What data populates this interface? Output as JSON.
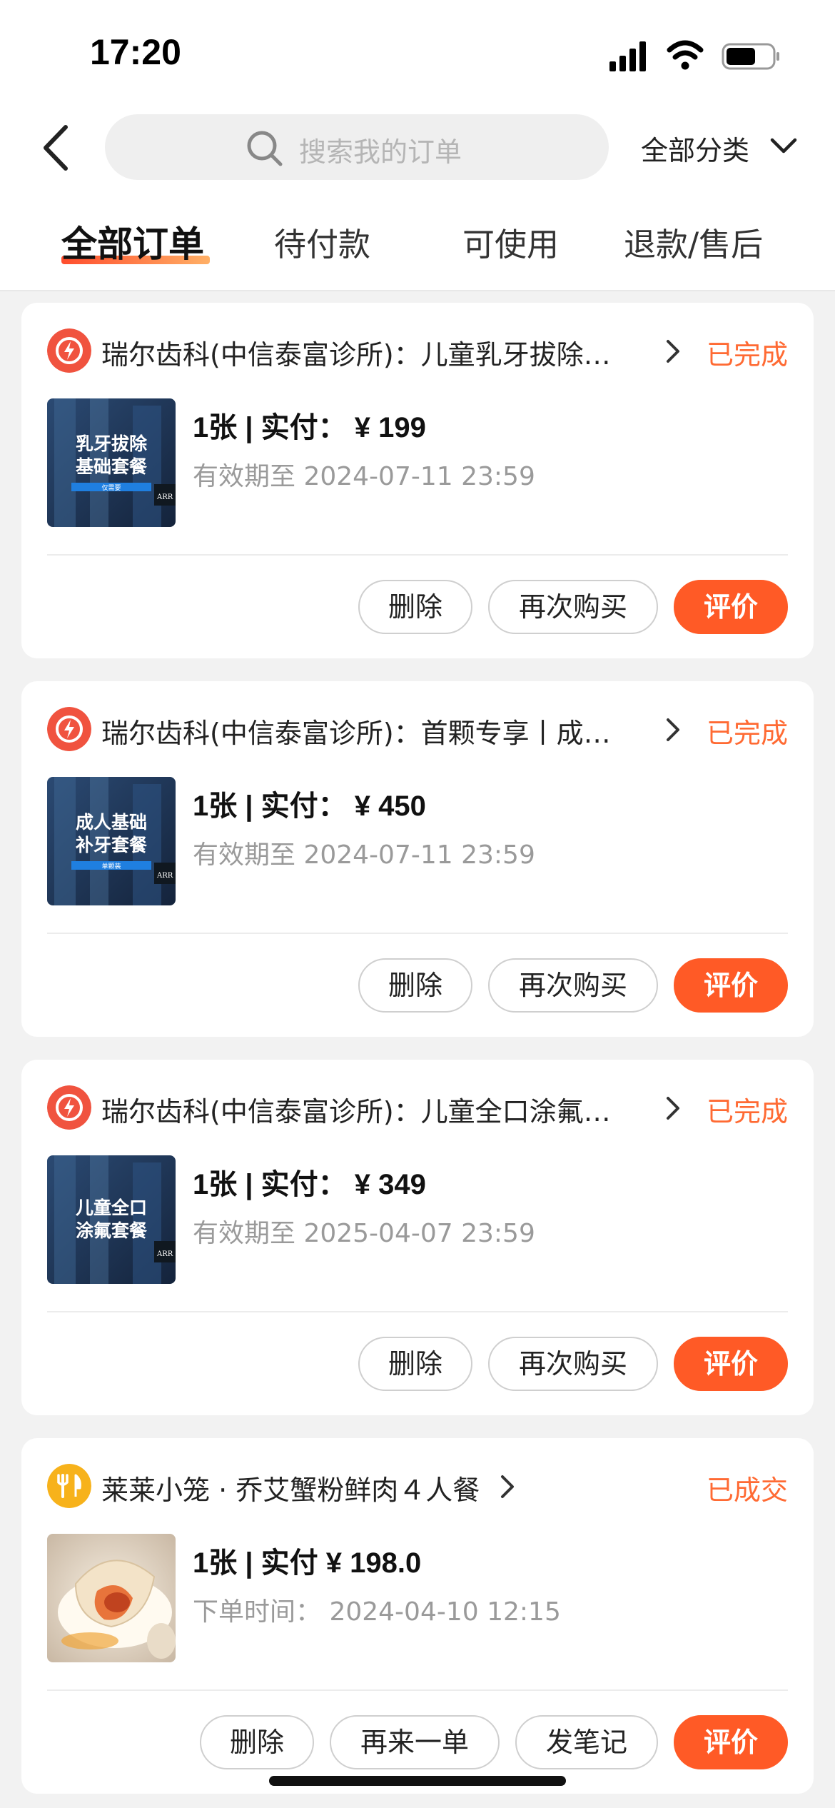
{
  "status_bar": {
    "time": "17:20"
  },
  "header": {
    "search_placeholder": "搜索我的订单",
    "category_label": "全部分类"
  },
  "tabs": [
    {
      "label": "全部订单",
      "active": true
    },
    {
      "label": "待付款",
      "active": false
    },
    {
      "label": "可使用",
      "active": false
    },
    {
      "label": "退款/售后",
      "active": false
    }
  ],
  "orders": [
    {
      "shop_icon": "lightning-icon",
      "title": "瑞尔齿科(中信泰富诊所)：儿童乳牙拔除…",
      "status": "已完成",
      "thumb_text": [
        "乳牙拔除",
        "基础套餐"
      ],
      "thumb_tag": "仅需要",
      "price_line": "1张 | 实付： ¥ 199",
      "detail": "有效期至 2024-07-11 23:59",
      "buttons": [
        "删除",
        "再次购买",
        "评价"
      ]
    },
    {
      "shop_icon": "lightning-icon",
      "title": "瑞尔齿科(中信泰富诊所)：首颗专享丨成…",
      "status": "已完成",
      "thumb_text": [
        "成人基础",
        "补牙套餐"
      ],
      "thumb_tag": "单颗装",
      "price_line": "1张 | 实付： ¥ 450",
      "detail": "有效期至 2024-07-11 23:59",
      "buttons": [
        "删除",
        "再次购买",
        "评价"
      ]
    },
    {
      "shop_icon": "lightning-icon",
      "title": "瑞尔齿科(中信泰富诊所)：儿童全口涂氟…",
      "status": "已完成",
      "thumb_text": [
        "儿童全口",
        "涂氟套餐"
      ],
      "thumb_tag": "",
      "price_line": "1张 | 实付： ¥ 349",
      "detail": "有效期至 2025-04-07 23:59",
      "buttons": [
        "删除",
        "再次购买",
        "评价"
      ]
    },
    {
      "shop_icon": "fork-knife-icon",
      "title": "莱莱小笼 · 乔艾蟹粉鲜肉４人餐",
      "status": "已成交",
      "thumb_text": [],
      "thumb_tag": "",
      "price_line": "1张 | 实付 ¥ 198.0",
      "detail": "下单时间： 2024-04-10 12:15",
      "buttons": [
        "删除",
        "再来一单",
        "发笔记",
        "评价"
      ]
    }
  ],
  "thumb_watermark": "ARR",
  "colors": {
    "accent": "#ff5a26",
    "status": "#ff6a33",
    "dental_icon": "#f0533f",
    "food_icon": "#f7b21b"
  }
}
